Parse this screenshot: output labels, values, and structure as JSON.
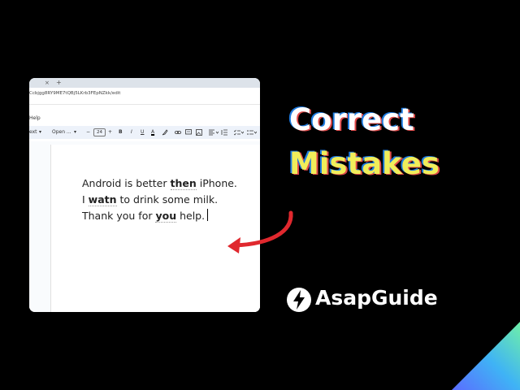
{
  "browser": {
    "tab_close": "×",
    "tab_new": "+",
    "url": "Ccbjgg8RY9ME7tQBj5LKrb3FEpNZkk/edit"
  },
  "docs": {
    "menu_help": "Help",
    "toolbar": {
      "style": "ext",
      "font": "Open ...",
      "font_arrow": "▾",
      "minus": "−",
      "font_size": "24",
      "plus": "+",
      "bold": "B",
      "italic": "I",
      "underline": "U",
      "text_color": "A"
    },
    "lines": [
      {
        "pre": "Android is better ",
        "err": "then",
        "post": " iPhone."
      },
      {
        "pre": "I ",
        "err": "watn",
        "post": "  to drink some milk."
      },
      {
        "pre": "Thank you for ",
        "err": "you",
        "post": " help."
      }
    ]
  },
  "headline": {
    "line1": "Correct",
    "line2": "Mistakes"
  },
  "brand": {
    "name": "AsapGuide"
  },
  "colors": {
    "headline_yellow": "#f0ee5a",
    "arrow_red": "#e0282e",
    "background": "#000000"
  }
}
